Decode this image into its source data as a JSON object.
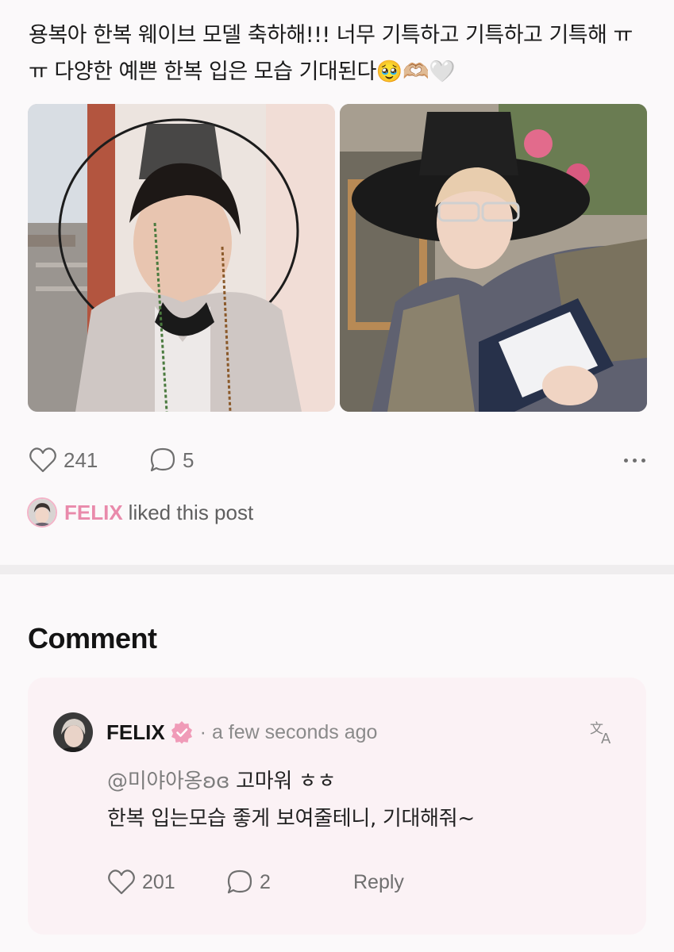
{
  "post": {
    "text": "용복아 한복 웨이브 모델 축하해!!! 너무 기특하고 기특하고 기특해 ㅠㅠ 다양한 예쁜 한복 입은 모습 기대된다🥹🫶🏼🤍",
    "images": [
      {
        "description_icon": "photo-hanbok-portrait"
      },
      {
        "description_icon": "photo-hanbok-reading"
      }
    ],
    "likes": "241",
    "comments": "5",
    "liked_by_name": "FELIX",
    "liked_by_suffix": "liked this post"
  },
  "comments_section": {
    "heading": "Comment",
    "items": [
      {
        "author": "FELIX",
        "time": "· a few seconds ago",
        "mention": "@미야아옹ʚɞ",
        "line1_rest": " 고마워 ㅎㅎ",
        "line2": "한복 입는모습 좋게 보여줄테니, 기대해줘~",
        "likes": "201",
        "replies": "2",
        "reply_label": "Reply"
      }
    ]
  },
  "colors": {
    "accent_pink": "#e98aab",
    "card_bg": "#fbf2f5",
    "page_bg": "#fbf9fa"
  },
  "icons": [
    "heart-icon",
    "speech-bubble-icon",
    "more-dots-icon",
    "verified-badge-icon",
    "translate-icon"
  ]
}
